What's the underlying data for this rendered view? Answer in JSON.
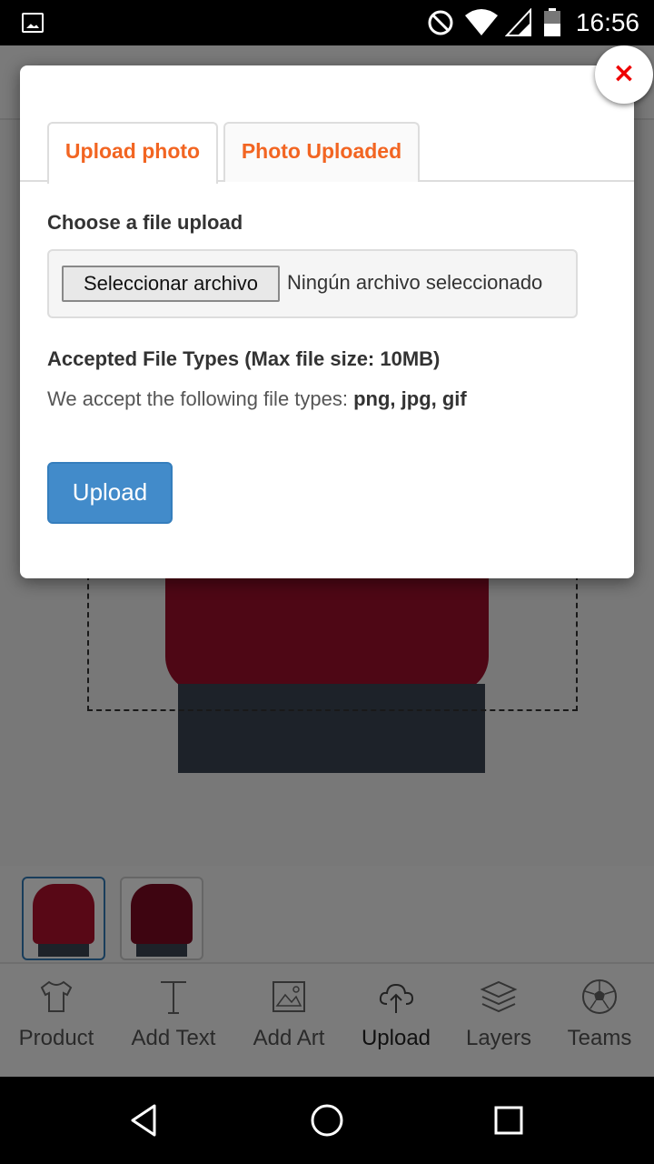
{
  "status_bar": {
    "time": "16:56",
    "icons": [
      "image-notification-icon",
      "do-not-disturb-icon",
      "wifi-icon",
      "signal-icon",
      "battery-icon"
    ]
  },
  "thumbnails": [
    {
      "name": "front-view",
      "active": true
    },
    {
      "name": "back-view",
      "active": false
    }
  ],
  "toolbar": {
    "items": [
      {
        "label": "Product",
        "icon": "tshirt-icon"
      },
      {
        "label": "Add Text",
        "icon": "text-icon"
      },
      {
        "label": "Add Art",
        "icon": "image-icon"
      },
      {
        "label": "Upload",
        "icon": "cloud-upload-icon"
      },
      {
        "label": "Layers",
        "icon": "layers-icon"
      },
      {
        "label": "Teams",
        "icon": "soccer-ball-icon"
      }
    ]
  },
  "modal": {
    "close_label": "×",
    "tabs": [
      {
        "label": "Upload photo",
        "active": true
      },
      {
        "label": "Photo Uploaded",
        "active": false
      }
    ],
    "choose_title": "Choose a file upload",
    "file_button_label": "Seleccionar archivo",
    "file_status": "Ningún archivo seleccionado",
    "types_title": "Accepted File Types (Max file size: 10MB)",
    "types_prefix": "We accept the following file types: ",
    "types_list": "png, jpg, gif",
    "upload_label": "Upload"
  },
  "colors": {
    "tab_text": "#f26522",
    "upload_button": "#428bca",
    "close_x": "#e00000",
    "hoodie": "#9c0f2a"
  },
  "nav_bar": {
    "icons": [
      "back-icon",
      "home-icon",
      "recents-icon"
    ]
  }
}
